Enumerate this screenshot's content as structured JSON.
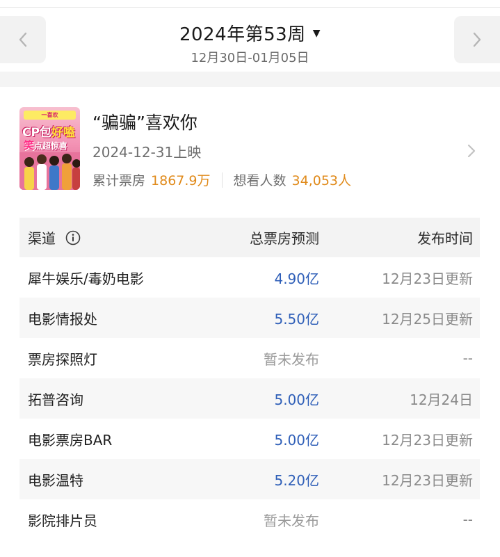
{
  "header": {
    "week_title": "2024年第53周",
    "dropdown_glyph": "▼",
    "date_range": "12月30日-01月05日",
    "prev_glyph": "chevron-left-icon",
    "next_glyph": "chevron-right-icon"
  },
  "movie": {
    "title": "“骗骗”喜欢你",
    "release_date": "2024-12-31上映",
    "box_office_label": "累计票房",
    "box_office_value": "1867.9万",
    "want_label": "想看人数",
    "want_value": "34,053人",
    "poster": {
      "banner": "一喜欢",
      "line1_a": "CP包",
      "line1_b": "好嗑",
      "line2_a": "笑",
      "line2_b": "点超惊喜"
    }
  },
  "table": {
    "headers": {
      "channel": "渠道",
      "prediction": "总票房预测",
      "publish_time": "发布时间"
    },
    "rows": [
      {
        "channel": "犀牛娱乐/毒奶电影",
        "prediction": "4.90亿",
        "publish_time": "12月23日更新",
        "published": true
      },
      {
        "channel": "电影情报处",
        "prediction": "5.50亿",
        "publish_time": "12月25日更新",
        "published": true
      },
      {
        "channel": "票房探照灯",
        "prediction": "暂未发布",
        "publish_time": "--",
        "published": false
      },
      {
        "channel": "拓普咨询",
        "prediction": "5.00亿",
        "publish_time": "12月24日",
        "published": true
      },
      {
        "channel": "电影票房BAR",
        "prediction": "5.00亿",
        "publish_time": "12月23日更新",
        "published": true
      },
      {
        "channel": "电影温特",
        "prediction": "5.20亿",
        "publish_time": "12月23日更新",
        "published": true
      },
      {
        "channel": "影院排片员",
        "prediction": "暂未发布",
        "publish_time": "--",
        "published": false
      }
    ]
  },
  "colors": {
    "accent_orange": "#e08a1a",
    "prediction_blue": "#2f5fb8",
    "muted_gray": "#9a9a9a"
  }
}
